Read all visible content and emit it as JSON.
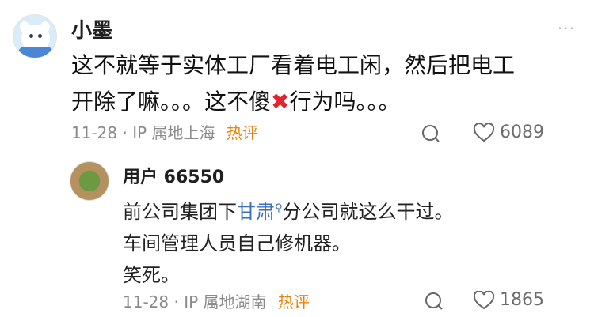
{
  "main_comment": {
    "username": "小墨",
    "text_line1": "这不就等于实体工厂看着电工闲，然后把电工",
    "text_line2_a": "开除了嘛。。。这不傻",
    "text_line2_emoji": "✖",
    "text_line2_b": "行为吗。。。",
    "date": "11-28",
    "separator": "·",
    "location": "IP 属地上海",
    "hot_tag": "热评",
    "like_count": "6089"
  },
  "reply": {
    "username": "用户 66550",
    "line1_a": "前公司集团下",
    "line1_link": "甘肃",
    "line1_b": "分公司就这么干过。",
    "line2": "车间管理人员自己修机器。",
    "line3": "笑死。",
    "date": "11-28",
    "separator": "·",
    "location": "IP 属地湖南",
    "hot_tag": "热评",
    "like_count": "1865"
  },
  "icons": {
    "more": "more-dots-icon",
    "comment": "comment-bubble-icon",
    "like": "heart-icon",
    "cross": "red-cross-emoji",
    "search": "search-icon"
  },
  "colors": {
    "hot": "#e7830f",
    "link": "#3b6fb6",
    "emoji": "#e0252f"
  }
}
